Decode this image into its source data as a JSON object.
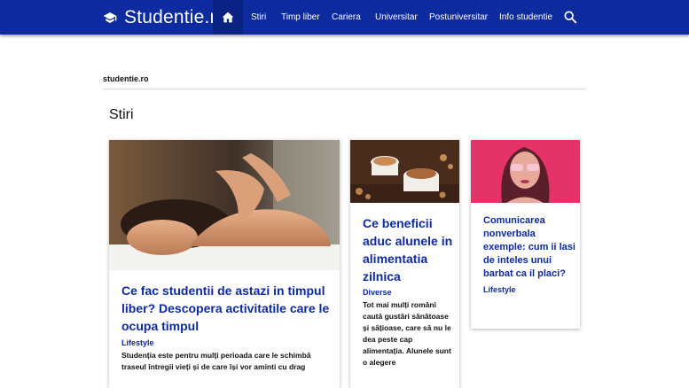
{
  "header": {
    "brand": "Studentie.ro",
    "nav": [
      "Stiri",
      "Timp liber",
      "Cariera",
      "Universitar",
      "Postuniversitar",
      "Info studentie"
    ],
    "accent_color": "#0d2a9e",
    "icons": [
      "graduation-cap-icon",
      "home-icon",
      "search-icon"
    ]
  },
  "breadcrumb": "studentie.ro",
  "section_title": "Stiri",
  "cards": [
    {
      "title": "Ce fac studentii de astazi in timpul liber? Descopera activitatile care le ocupa timpul",
      "category": "Lifestyle",
      "excerpt": "Studenția este pentru mulți perioada care le schimbă traseul întregii vieți și de care își vor aminti cu drag"
    },
    {
      "title": "Ce beneficii aduc alunele in alimentatia zilnica",
      "category": "Diverse",
      "excerpt": "Tot mai mulți români caută gustări sănătoase și sățioase, care să nu le dea peste cap alimentația. Alunele sunt o alegere"
    },
    {
      "title": "Comunicarea nonverbala exemple: cum ii lasi de inteles unui barbat ca il placi?",
      "category": "Lifestyle",
      "excerpt": ""
    }
  ]
}
